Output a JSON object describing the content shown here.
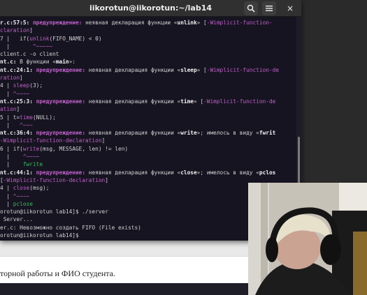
{
  "window": {
    "title": "iikorotun@iikorotun:~/lab14",
    "search_icon": "search-icon",
    "menu_icon": "hamburger-menu-icon",
    "close_icon": "close-icon",
    "close_glyph": "×"
  },
  "background_doc": {
    "visible_text": "торной работы и ФИО студента."
  },
  "terminal": {
    "lines": [
      [
        {
          "t": "r.c:57:5: ",
          "c": "b"
        },
        {
          "t": "предупреждение: ",
          "c": "m"
        },
        {
          "t": "неявная декларация функции «",
          "c": ""
        },
        {
          "t": "unlink",
          "c": "b"
        },
        {
          "t": "» [",
          "c": ""
        },
        {
          "t": "-Wimplicit-function-",
          "c": "w"
        }
      ],
      [
        {
          "t": "claration",
          "c": "w"
        },
        {
          "t": "]",
          "c": ""
        }
      ],
      [
        {
          "t": "7 |   ",
          "c": ""
        },
        {
          "t": "if(",
          "c": ""
        },
        {
          "t": "unlink",
          "c": "w"
        },
        {
          "t": "(FIFO_NAME) < 0)",
          "c": ""
        }
      ],
      [
        {
          "t": "  |       ",
          "c": ""
        },
        {
          "t": "^~~~~~",
          "c": "w"
        }
      ],
      [
        {
          "t": "client.c -o client",
          "c": ""
        }
      ],
      [
        {
          "t": "nt.c:",
          "c": "b"
        },
        {
          "t": " В функции «",
          "c": ""
        },
        {
          "t": "main",
          "c": "b"
        },
        {
          "t": "»:",
          "c": ""
        }
      ],
      [
        {
          "t": "nt.c:24:1: ",
          "c": "b"
        },
        {
          "t": "предупреждение: ",
          "c": "m"
        },
        {
          "t": "неявная декларация функции «",
          "c": ""
        },
        {
          "t": "sleep",
          "c": "b"
        },
        {
          "t": "» [",
          "c": ""
        },
        {
          "t": "-Wimplicit-function-de",
          "c": "w"
        }
      ],
      [
        {
          "t": "ration",
          "c": "w"
        },
        {
          "t": "]",
          "c": ""
        }
      ],
      [
        {
          "t": "4 | ",
          "c": ""
        },
        {
          "t": "sleep",
          "c": "w"
        },
        {
          "t": "(3);",
          "c": ""
        }
      ],
      [
        {
          "t": "  | ",
          "c": ""
        },
        {
          "t": "^~~~~",
          "c": "w"
        }
      ],
      [
        {
          "t": "nt.c:25:3: ",
          "c": "b"
        },
        {
          "t": "предупреждение: ",
          "c": "m"
        },
        {
          "t": "неявная декларация функции «",
          "c": ""
        },
        {
          "t": "time",
          "c": "b"
        },
        {
          "t": "» [",
          "c": ""
        },
        {
          "t": "-Wimplicit-function-de",
          "c": "w"
        }
      ],
      [
        {
          "t": "ation",
          "c": "w"
        },
        {
          "t": "]",
          "c": ""
        }
      ],
      [
        {
          "t": "5 | t=",
          "c": ""
        },
        {
          "t": "time",
          "c": "w"
        },
        {
          "t": "(NULL);",
          "c": ""
        }
      ],
      [
        {
          "t": "  |   ",
          "c": ""
        },
        {
          "t": "^~~~",
          "c": "w"
        }
      ],
      [
        {
          "t": "nt.c:36:4: ",
          "c": "b"
        },
        {
          "t": "предупреждение: ",
          "c": "m"
        },
        {
          "t": "неявная декларация функции «",
          "c": ""
        },
        {
          "t": "write",
          "c": "b"
        },
        {
          "t": "»; имелось в виду «",
          "c": ""
        },
        {
          "t": "fwrit",
          "c": "b"
        }
      ],
      [
        {
          "t": "-Wimplicit-function-declaration",
          "c": "w"
        },
        {
          "t": "]",
          "c": ""
        }
      ],
      [
        {
          "t": "6 | if(",
          "c": ""
        },
        {
          "t": "write",
          "c": "w"
        },
        {
          "t": "(msg, MESSAGE, len) != len)",
          "c": ""
        }
      ],
      [
        {
          "t": "  |    ",
          "c": ""
        },
        {
          "t": "^~~~~",
          "c": "w"
        }
      ],
      [
        {
          "t": "  |    ",
          "c": ""
        },
        {
          "t": "fwrite",
          "c": "g"
        }
      ],
      [
        {
          "t": "nt.c:44:1: ",
          "c": "b"
        },
        {
          "t": "предупреждение: ",
          "c": "m"
        },
        {
          "t": "неявная декларация функции «",
          "c": ""
        },
        {
          "t": "close",
          "c": "b"
        },
        {
          "t": "»; имелось в виду «",
          "c": ""
        },
        {
          "t": "pclos",
          "c": "b"
        }
      ],
      [
        {
          "t": "[",
          "c": ""
        },
        {
          "t": "-Wimplicit-function-declaration",
          "c": "w"
        },
        {
          "t": "]",
          "c": ""
        }
      ],
      [
        {
          "t": "4 | ",
          "c": ""
        },
        {
          "t": "close",
          "c": "w"
        },
        {
          "t": "(msg);",
          "c": ""
        }
      ],
      [
        {
          "t": "  | ",
          "c": ""
        },
        {
          "t": "^~~~~",
          "c": "w"
        }
      ],
      [
        {
          "t": "  | ",
          "c": ""
        },
        {
          "t": "pclose",
          "c": "g"
        }
      ],
      [
        {
          "t": "orotun@iikorotun lab14]$ ./server",
          "c": ""
        }
      ],
      [
        {
          "t": " Server...",
          "c": ""
        }
      ],
      [
        {
          "t": "er.c: Невозможно создать FIFO (File exists)",
          "c": ""
        }
      ],
      [
        {
          "t": "orotun@iikorotun lab14]$ ",
          "c": ""
        }
      ]
    ]
  }
}
